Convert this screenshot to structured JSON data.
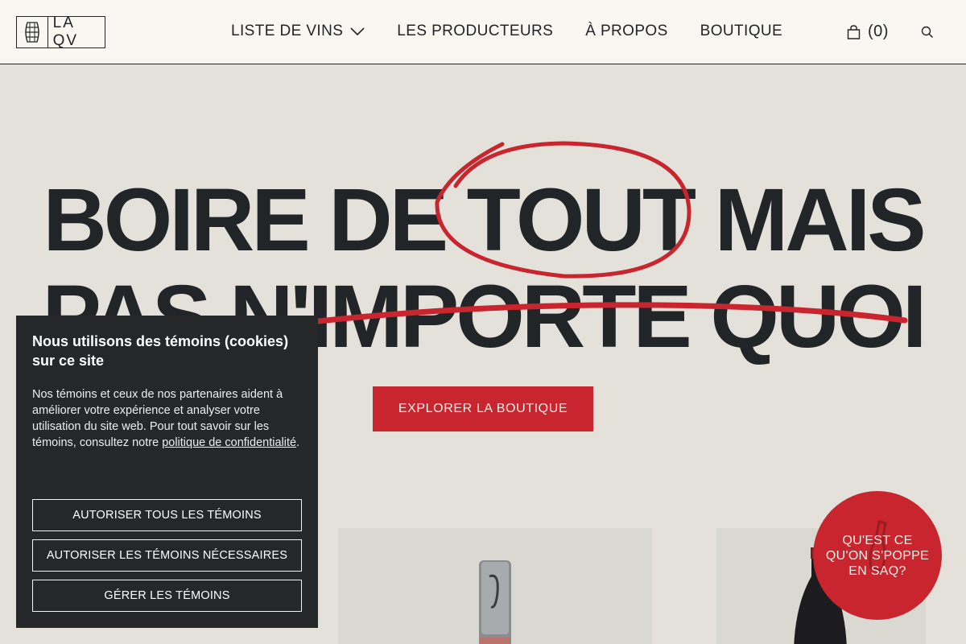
{
  "header": {
    "logo_text": "LA QV",
    "nav": [
      {
        "label": "LISTE DE VINS",
        "has_dropdown": true
      },
      {
        "label": "LES PRODUCTEURS"
      },
      {
        "label": "À PROPOS"
      },
      {
        "label": "BOUTIQUE"
      }
    ],
    "cart_count": "(0)"
  },
  "hero": {
    "line1_before": "BOIRE DE ",
    "line1_circled": "TOUT",
    "line1_after": " MAIS",
    "line2": "PAS N'IMPORTE QUOI",
    "cta_label": "EXPLORER LA BOUTIQUE"
  },
  "saq_badge": {
    "line1": "QU'EST CE",
    "line2": "QU'ON S'POPPE",
    "line3": "EN SAQ?"
  },
  "cookie": {
    "title": "Nous utilisons des témoins (cookies) sur ce site",
    "body": "Nos témoins et ceux de nos partenaires aident à améliorer votre expérience et analyser votre utilisation du site web. Pour tout savoir sur les témoins, consultez notre ",
    "link": "politique de confidentialité",
    "body_end": ".",
    "buttons": {
      "allow_all": "AUTORISER TOUS LES TÉMOINS",
      "allow_necessary": "AUTORISER LES TÉMOINS NÉCESSAIRES",
      "manage": "GÉRER LES TÉMOINS"
    }
  },
  "colors": {
    "accent_red": "#c8252e",
    "ink": "#222528",
    "background": "#e3e1d9",
    "header_bg": "#f8f7f1",
    "cookie_bg": "#252729"
  }
}
